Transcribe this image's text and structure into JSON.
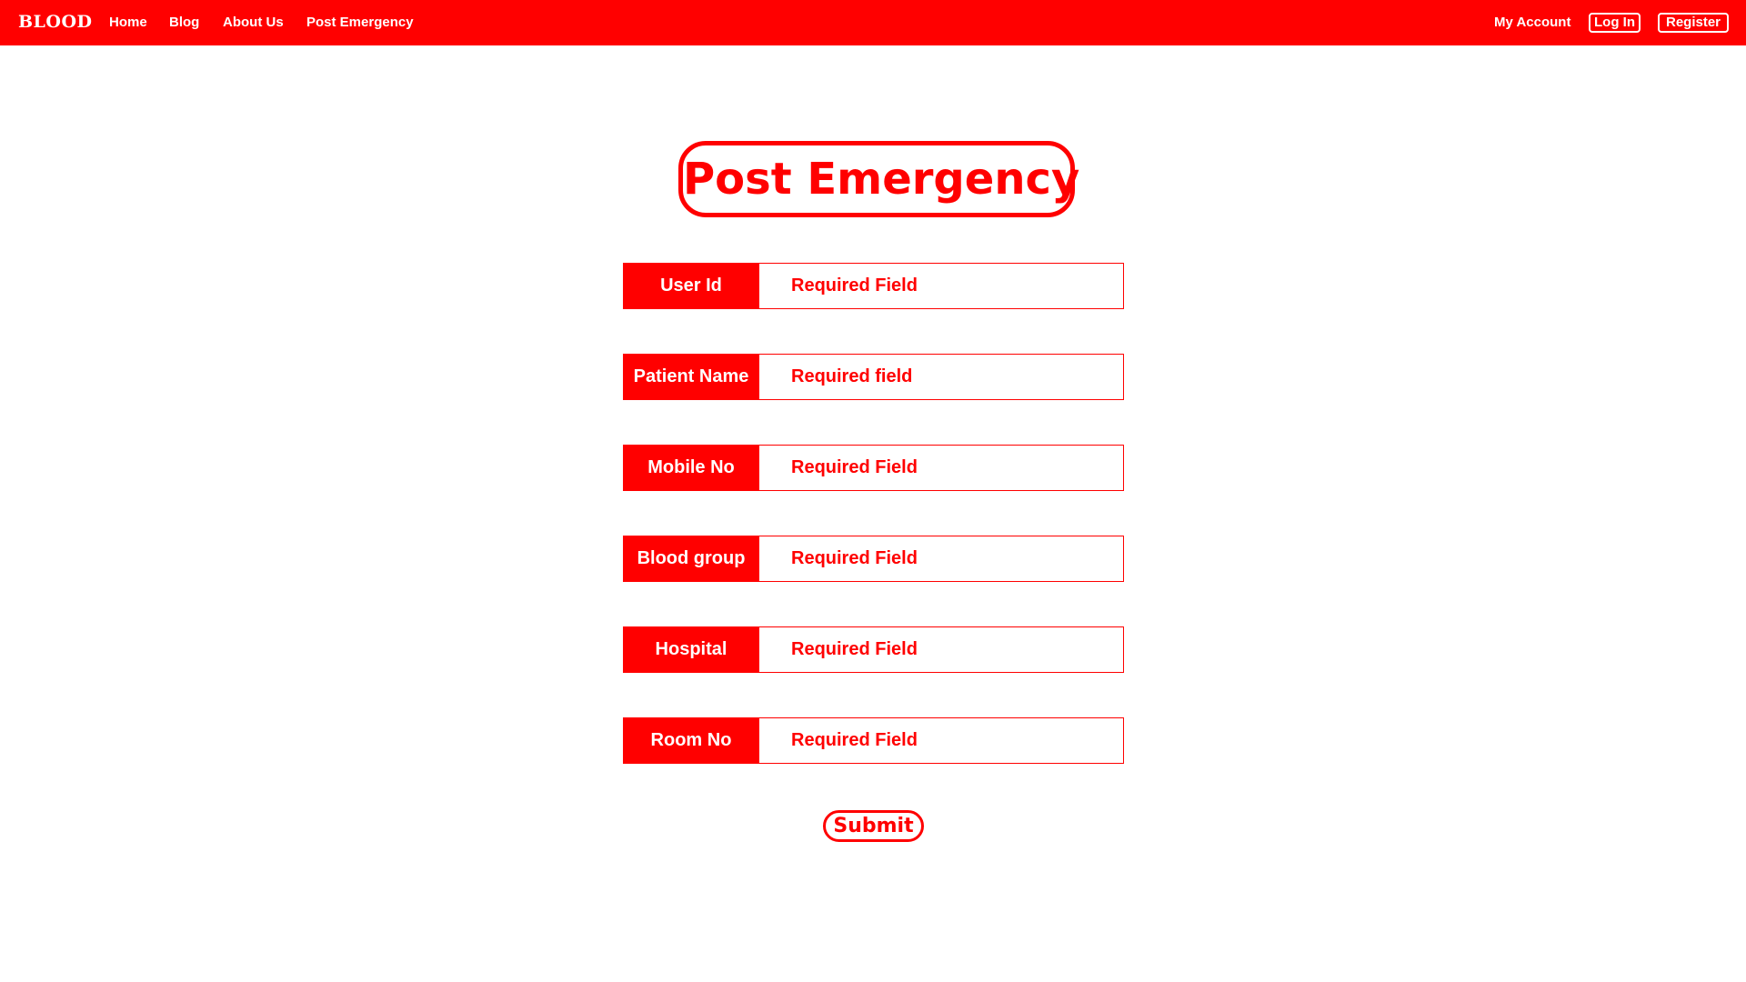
{
  "navbar": {
    "brand": "BLOOD",
    "links": {
      "home": "Home",
      "blog": "Blog",
      "about": "About Us",
      "post_emergency": "Post Emergency"
    },
    "my_account": "My Account",
    "login": "Log In",
    "register": "Register"
  },
  "page": {
    "title": "Post Emergency"
  },
  "form": {
    "fields": [
      {
        "label": "User Id",
        "placeholder": "Required Field"
      },
      {
        "label": "Patient Name",
        "placeholder": "Required field"
      },
      {
        "label": "Mobile No",
        "placeholder": "Required Field"
      },
      {
        "label": "Blood group",
        "placeholder": "Required Field"
      },
      {
        "label": "Hospital",
        "placeholder": "Required Field"
      },
      {
        "label": "Room No",
        "placeholder": "Required Field"
      }
    ],
    "submit_label": "Submit"
  },
  "colors": {
    "primary": "#ff0000",
    "background": "#ffffff",
    "on_primary": "#ffffff"
  }
}
